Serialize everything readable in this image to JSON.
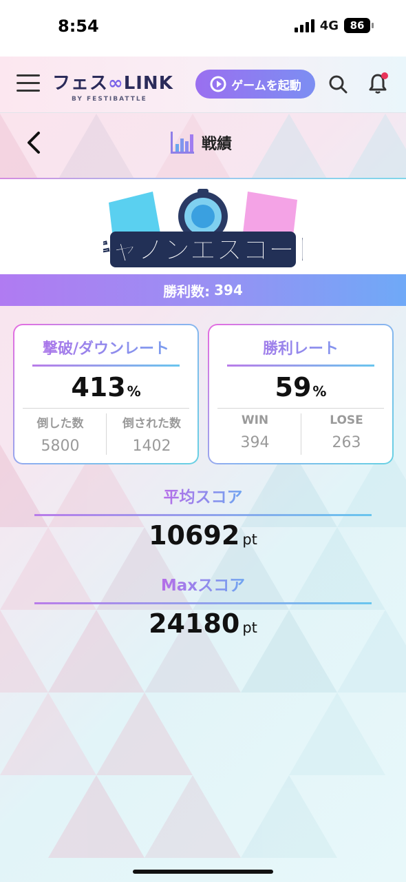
{
  "status_bar": {
    "time": "8:54",
    "network": "4G",
    "battery": "86"
  },
  "header": {
    "logo_text": "フェス",
    "logo_text_2": "LINK",
    "logo_sub": "BY FESTIBATTLE",
    "launch_button": "ゲームを起動"
  },
  "page": {
    "title": "戦績"
  },
  "game": {
    "name": "キャノンエスコート"
  },
  "wins": {
    "label": "勝利数:",
    "value": "394"
  },
  "kd_card": {
    "title": "撃破/ダウンレート",
    "value": "413",
    "unit": "%",
    "left_label": "倒した数",
    "left_value": "5800",
    "right_label": "倒された数",
    "right_value": "1402"
  },
  "win_card": {
    "title": "勝利レート",
    "value": "59",
    "unit": "%",
    "left_label": "WIN",
    "left_value": "394",
    "right_label": "LOSE",
    "right_value": "263"
  },
  "avg_score": {
    "title": "平均スコア",
    "value": "10692",
    "unit": "pt"
  },
  "max_score": {
    "title": "Maxスコア",
    "value": "24180",
    "unit": "pt"
  },
  "colors": {
    "accent_purple": "#9a6ff0",
    "accent_blue": "#6fa9f7",
    "accent_pink": "#e56be0"
  }
}
